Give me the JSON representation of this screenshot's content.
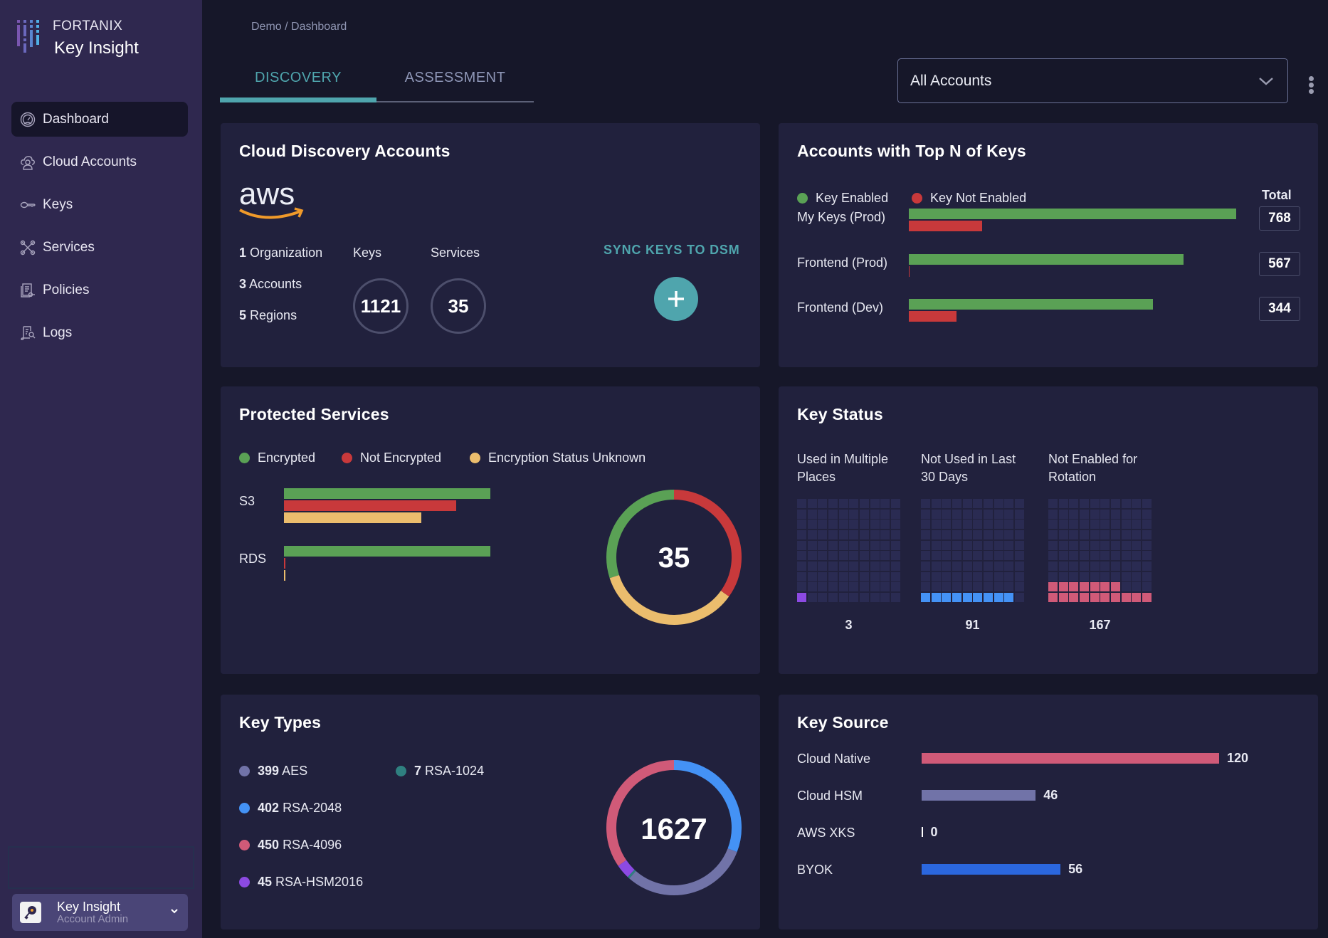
{
  "sidebar": {
    "brand": "FORTANIX",
    "product": "Key Insight",
    "items": [
      {
        "label": "Dashboard",
        "icon": "dashboard-gauge-icon",
        "active": true
      },
      {
        "label": "Cloud Accounts",
        "icon": "cloud-user-icon",
        "active": false
      },
      {
        "label": "Keys",
        "icon": "key-icon",
        "active": false
      },
      {
        "label": "Services",
        "icon": "tools-icon",
        "active": false
      },
      {
        "label": "Policies",
        "icon": "policy-document-icon",
        "active": false
      },
      {
        "label": "Logs",
        "icon": "log-search-icon",
        "active": false
      }
    ],
    "account": {
      "name": "Key Insight",
      "role": "Account Admin"
    }
  },
  "header": {
    "breadcrumb": "Demo / Dashboard",
    "tabs": [
      {
        "label": "DISCOVERY",
        "active": true
      },
      {
        "label": "ASSESSMENT",
        "active": false
      }
    ],
    "account_select": {
      "value": "All Accounts"
    }
  },
  "colors": {
    "accent": "#4fa5ad",
    "green": "#5aa155",
    "red": "#c8393b",
    "yellow": "#ebbd6d",
    "aes": "#7173a8",
    "rsa2048": "#4492f5",
    "rsa4096": "#d05a78",
    "rsahsm": "#8c4ae2",
    "rsa1024": "#2f8080",
    "byok": "#2b67de"
  },
  "cloud_discovery": {
    "title": "Cloud Discovery Accounts",
    "provider": "aws",
    "stats": [
      {
        "count": "1",
        "label": "Organization"
      },
      {
        "count": "3",
        "label": "Accounts"
      },
      {
        "count": "5",
        "label": "Regions"
      }
    ],
    "keys_label": "Keys",
    "keys_value": "1121",
    "services_label": "Services",
    "services_value": "35",
    "sync_label": "SYNC KEYS TO DSM"
  },
  "chart_data": [
    {
      "id": "top-n-keys",
      "type": "bar",
      "title": "Accounts with Top N of Keys",
      "orientation": "horizontal",
      "categories": [
        "My Keys (Prod)",
        "Frontend (Prod)",
        "Frontend (Dev)"
      ],
      "series": [
        {
          "name": "Key Enabled",
          "values": [
            650,
            545,
            484
          ]
        },
        {
          "name": "Key Not Enabled",
          "values": [
            146,
            2,
            95
          ]
        }
      ],
      "totals": [
        768,
        567,
        344
      ],
      "total_header": "Total",
      "legend": "top-left"
    },
    {
      "id": "protected-services",
      "type": "bar",
      "title": "Protected Services",
      "orientation": "horizontal",
      "categories": [
        "S3",
        "RDS"
      ],
      "series": [
        {
          "name": "Encrypted",
          "values": [
            12,
            12
          ]
        },
        {
          "name": "Not Encrypted",
          "values": [
            10,
            0
          ]
        },
        {
          "name": "Encryption Status Unknown",
          "values": [
            8,
            0
          ]
        }
      ],
      "donut": {
        "center_label": "35",
        "slices": [
          {
            "name": "Not Encrypted",
            "value": 12.2
          },
          {
            "name": "Encryption Status Unknown",
            "value": 12.3
          },
          {
            "name": "Encrypted",
            "value": 10.5
          }
        ]
      },
      "legend": "top-left"
    },
    {
      "id": "key-status",
      "type": "heatmap",
      "title": "Key Status",
      "panels": [
        {
          "label": "Used in Multiple Places",
          "value": "3",
          "filled_cells": 1,
          "color": "#8c4ae2"
        },
        {
          "label": "Not Used in Last 30 Days",
          "value": "91",
          "filled_cells": 9,
          "color": "#4492f5"
        },
        {
          "label": "Not Enabled for Rotation",
          "value": "167",
          "filled_cells": 17,
          "color": "#d05a78"
        }
      ],
      "grid": "10x10"
    },
    {
      "id": "key-types",
      "type": "pie",
      "title": "Key Types",
      "center_label": "1627",
      "slices": [
        {
          "name": "RSA-2048",
          "value": 402,
          "color_key": "rsa2048"
        },
        {
          "name": "AES",
          "value": 399,
          "color_key": "aes"
        },
        {
          "name": "RSA-1024",
          "value": 7,
          "color_key": "rsa1024"
        },
        {
          "name": "RSA-HSM2016",
          "value": 45,
          "color_key": "rsahsm"
        },
        {
          "name": "RSA-4096",
          "value": 450,
          "color_key": "rsa4096"
        }
      ],
      "legend_items": [
        {
          "count": "399",
          "name": "AES",
          "color_key": "aes"
        },
        {
          "count": "402",
          "name": "RSA-2048",
          "color_key": "rsa2048"
        },
        {
          "count": "450",
          "name": "RSA-4096",
          "color_key": "rsa4096"
        },
        {
          "count": "45",
          "name": "RSA-HSM2016",
          "color_key": "rsahsm"
        },
        {
          "count": "7",
          "name": "RSA-1024",
          "color_key": "rsa1024"
        }
      ]
    },
    {
      "id": "key-source",
      "type": "bar",
      "title": "Key Source",
      "orientation": "horizontal",
      "categories": [
        "Cloud Native",
        "Cloud HSM",
        "AWS XKS",
        "BYOK"
      ],
      "values": [
        120,
        46,
        0,
        56
      ],
      "value_labels": [
        "120",
        "46",
        "0",
        "56"
      ],
      "colors": [
        "#d05a78",
        "#7173a8",
        "#ffffff",
        "#2b67de"
      ],
      "xlim": [
        0,
        120
      ]
    }
  ]
}
